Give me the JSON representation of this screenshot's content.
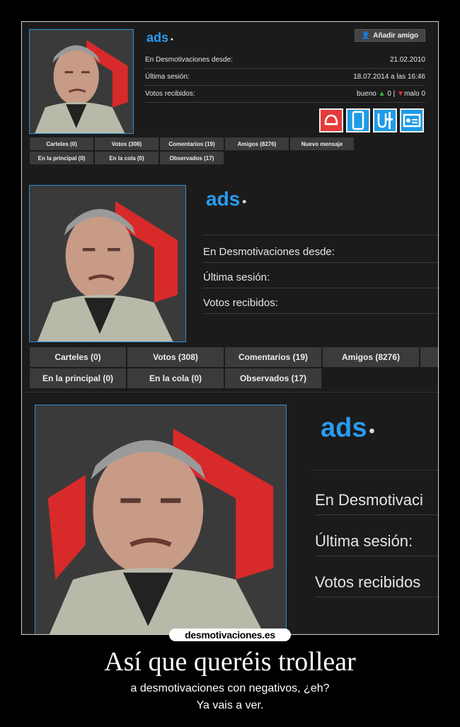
{
  "profile": {
    "username": "ads",
    "username_dot": "•",
    "add_friend_label": "Añadir amigo",
    "rows": [
      {
        "label": "En Desmotivaciones desde:",
        "value": "21.02.2010"
      },
      {
        "label": "Última sesión:",
        "value": "18.07.2014 a las 16:46"
      },
      {
        "label": "Votos recibidos:",
        "value": ""
      }
    ],
    "votes": {
      "good_label": "bueno",
      "good_count": "0",
      "separator": "|",
      "bad_label": "malo",
      "bad_count": "0"
    },
    "tabs_row1": [
      "Carteles (0)",
      "Votos (308)",
      "Comentarios (19)",
      "Amigos (8276)",
      "Nuevo mensaje"
    ],
    "tabs_row2": [
      "En la principal (0)",
      "En la cola (0)",
      "Observados (17)"
    ],
    "zoom_rows": [
      "En Desmotivaciones desde:",
      "Última sesión:",
      "Votos recibidos:"
    ],
    "zoom3_rows": [
      "En Desmotivaci",
      "Última sesión:",
      "Votos recibidos"
    ],
    "icons": [
      "helmet-icon",
      "phone-icon",
      "tools-icon",
      "id-card-icon"
    ]
  },
  "caption": {
    "logo": "desmotivaciones.es",
    "title": "Así que queréis trollear",
    "line1": "a desmotivaciones con negativos, ¿eh?",
    "line2": "Ya vais a ver."
  },
  "colors": {
    "accent": "#2a9bf0",
    "good": "#3fbf3f",
    "bad": "#e33333",
    "background": "#000000"
  }
}
